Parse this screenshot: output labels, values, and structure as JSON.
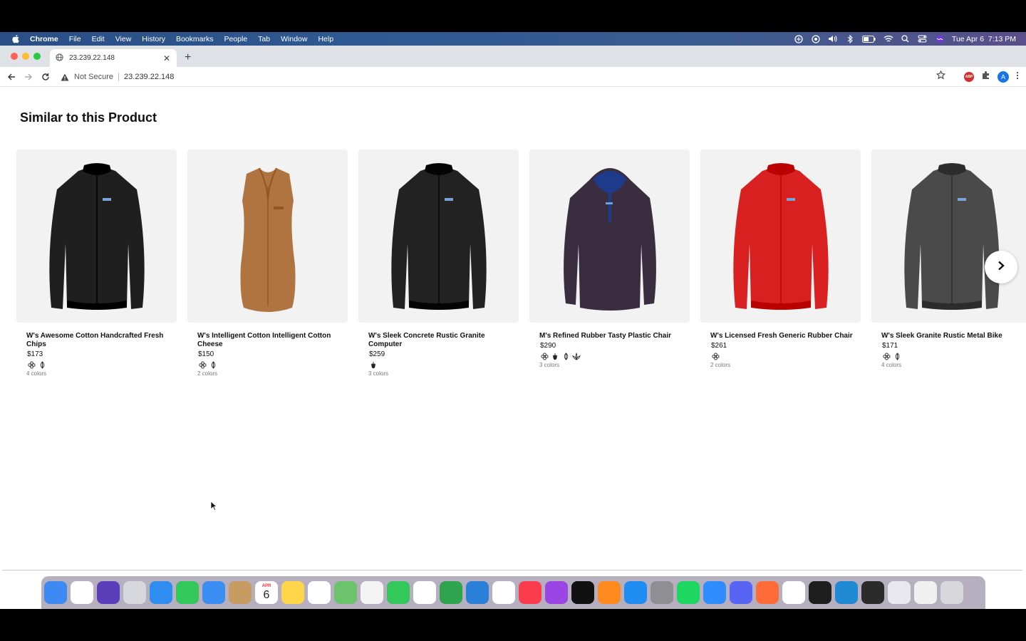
{
  "menubar": {
    "app": "Chrome",
    "items": [
      "File",
      "Edit",
      "View",
      "History",
      "Bookmarks",
      "People",
      "Tab",
      "Window",
      "Help"
    ],
    "clock": "Tue Apr 6  7:13 PM"
  },
  "browser": {
    "tab_title": "23.239.22.148",
    "security_label": "Not Secure",
    "url": "23.239.22.148",
    "profile_initial": "A",
    "adblock_label": "ABP"
  },
  "page": {
    "section_title": "Similar to this Product",
    "products": [
      {
        "name": "W's Awesome Cotton Handcrafted Fresh Chips",
        "price": "$173",
        "swatches": [
          "flower-icon",
          "leaf-icon"
        ],
        "colors": "4 colors",
        "garment": "jacket",
        "color": "#1f1f1f"
      },
      {
        "name": "W's Intelligent Cotton Intelligent Cotton Cheese",
        "price": "$150",
        "swatches": [
          "flower-icon",
          "leaf-icon"
        ],
        "colors": "2 colors",
        "garment": "vest",
        "color": "#b07440"
      },
      {
        "name": "W's Sleek Concrete Rustic Granite Computer",
        "price": "$259",
        "swatches": [
          "acorn-icon"
        ],
        "colors": "3 colors",
        "garment": "bomber",
        "color": "#222222"
      },
      {
        "name": "M's Refined Rubber Tasty Plastic Chair",
        "price": "$290",
        "swatches": [
          "flower-icon",
          "acorn-icon",
          "leaf-icon",
          "lotus-icon"
        ],
        "colors": "3 colors",
        "garment": "hoodie",
        "color": "#3a2d3f"
      },
      {
        "name": "W's Licensed Fresh Generic Rubber Chair",
        "price": "$261",
        "swatches": [
          "flower-icon"
        ],
        "colors": "2 colors",
        "garment": "jacket",
        "color": "#d82020"
      },
      {
        "name": "W's Sleek Granite Rustic Metal Bike",
        "price": "$171",
        "swatches": [
          "flower-icon",
          "leaf-icon"
        ],
        "colors": "4 colors",
        "garment": "bomber",
        "color": "#4a4a4a"
      }
    ]
  },
  "dock": {
    "calendar_month": "APR",
    "calendar_day": "6",
    "apps": [
      {
        "name": "finder",
        "color": "#3d8bf2"
      },
      {
        "name": "chrome",
        "color": "#ffffff"
      },
      {
        "name": "siri",
        "color": "#5a3db8"
      },
      {
        "name": "launchpad",
        "color": "#d7d7e0"
      },
      {
        "name": "safari",
        "color": "#2f8cf0"
      },
      {
        "name": "messages",
        "color": "#34c759"
      },
      {
        "name": "mail",
        "color": "#3c8df2"
      },
      {
        "name": "contacts",
        "color": "#c89b63"
      },
      {
        "name": "calendar",
        "color": "#ffffff"
      },
      {
        "name": "notes",
        "color": "#ffd54a"
      },
      {
        "name": "reminders",
        "color": "#ffffff"
      },
      {
        "name": "maps",
        "color": "#6cc36c"
      },
      {
        "name": "photos",
        "color": "#f3f3f3"
      },
      {
        "name": "facetime",
        "color": "#34c759"
      },
      {
        "name": "freeform",
        "color": "#ffffff"
      },
      {
        "name": "numbers",
        "color": "#2ea44f"
      },
      {
        "name": "keynote",
        "color": "#2a7fd9"
      },
      {
        "name": "news",
        "color": "#ffffff"
      },
      {
        "name": "music",
        "color": "#fa3c4c"
      },
      {
        "name": "podcasts",
        "color": "#9b45e4"
      },
      {
        "name": "tv",
        "color": "#111111"
      },
      {
        "name": "books",
        "color": "#ff8a1f"
      },
      {
        "name": "app-store",
        "color": "#1f8cf2"
      },
      {
        "name": "system-preferences",
        "color": "#8e8e93"
      },
      {
        "name": "spotify",
        "color": "#1ed760"
      },
      {
        "name": "zoom",
        "color": "#2d8cff"
      },
      {
        "name": "discord",
        "color": "#5865f2"
      },
      {
        "name": "postman",
        "color": "#ff6c37"
      },
      {
        "name": "slack",
        "color": "#ffffff"
      },
      {
        "name": "terminal",
        "color": "#1e1e1e"
      },
      {
        "name": "vscode",
        "color": "#1f8ad2"
      },
      {
        "name": "activity-monitor",
        "color": "#2b2b2b"
      },
      {
        "name": "preview",
        "color": "#e8e8ee"
      },
      {
        "name": "downloads-stack",
        "color": "#f0f0f0"
      },
      {
        "name": "trash",
        "color": "#d8d8dc"
      }
    ]
  }
}
